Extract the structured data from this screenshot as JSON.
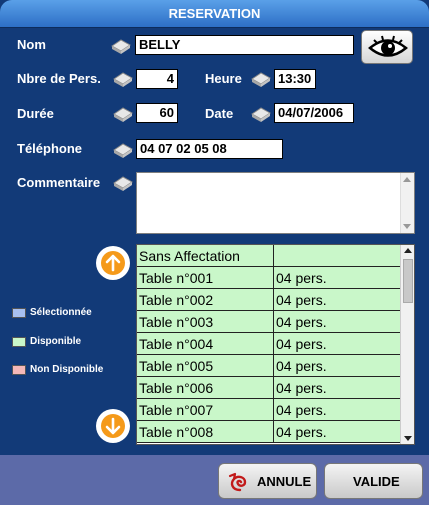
{
  "window": {
    "title": "RESERVATION"
  },
  "form": {
    "nom": {
      "label": "Nom",
      "value": "BELLY"
    },
    "nb_pers": {
      "label": "Nbre de Pers.",
      "value": "4"
    },
    "heure": {
      "label": "Heure",
      "value": "13:30"
    },
    "duree": {
      "label": "Durée",
      "value": "60"
    },
    "date": {
      "label": "Date",
      "value": "04/07/2006"
    },
    "telephone": {
      "label": "Téléphone",
      "value": "04 07 02 05 08"
    },
    "commentaire": {
      "label": "Commentaire",
      "value": ""
    }
  },
  "tables": {
    "rows": [
      {
        "name": "Sans Affectation",
        "capacity": ""
      },
      {
        "name": "Table n°001",
        "capacity": "04 pers."
      },
      {
        "name": "Table n°002",
        "capacity": "04 pers."
      },
      {
        "name": "Table n°003",
        "capacity": "04 pers."
      },
      {
        "name": "Table n°004",
        "capacity": "04 pers."
      },
      {
        "name": "Table n°005",
        "capacity": "04 pers."
      },
      {
        "name": "Table n°006",
        "capacity": "04 pers."
      },
      {
        "name": "Table n°007",
        "capacity": "04 pers."
      },
      {
        "name": "Table n°008",
        "capacity": "04 pers."
      }
    ]
  },
  "legend": {
    "selected": {
      "label": "Sélectionnée",
      "color": "#a8c0f0"
    },
    "available": {
      "label": "Disponible",
      "color": "#c9f7c9"
    },
    "unavailable": {
      "label": "Non Disponible",
      "color": "#f5b8b8"
    }
  },
  "actions": {
    "cancel_label": "ANNULE",
    "confirm_label": "VALIDE"
  },
  "colors": {
    "background": "#123a78",
    "bottom_bar": "#5c6aa8",
    "accent": "#f59a1a"
  },
  "icons": {
    "view": "eye-icon",
    "scroll_up": "arrow-up-icon",
    "scroll_down": "arrow-down-icon",
    "field_marker": "stone-icon",
    "cancel": "cancel-swirl-icon"
  }
}
